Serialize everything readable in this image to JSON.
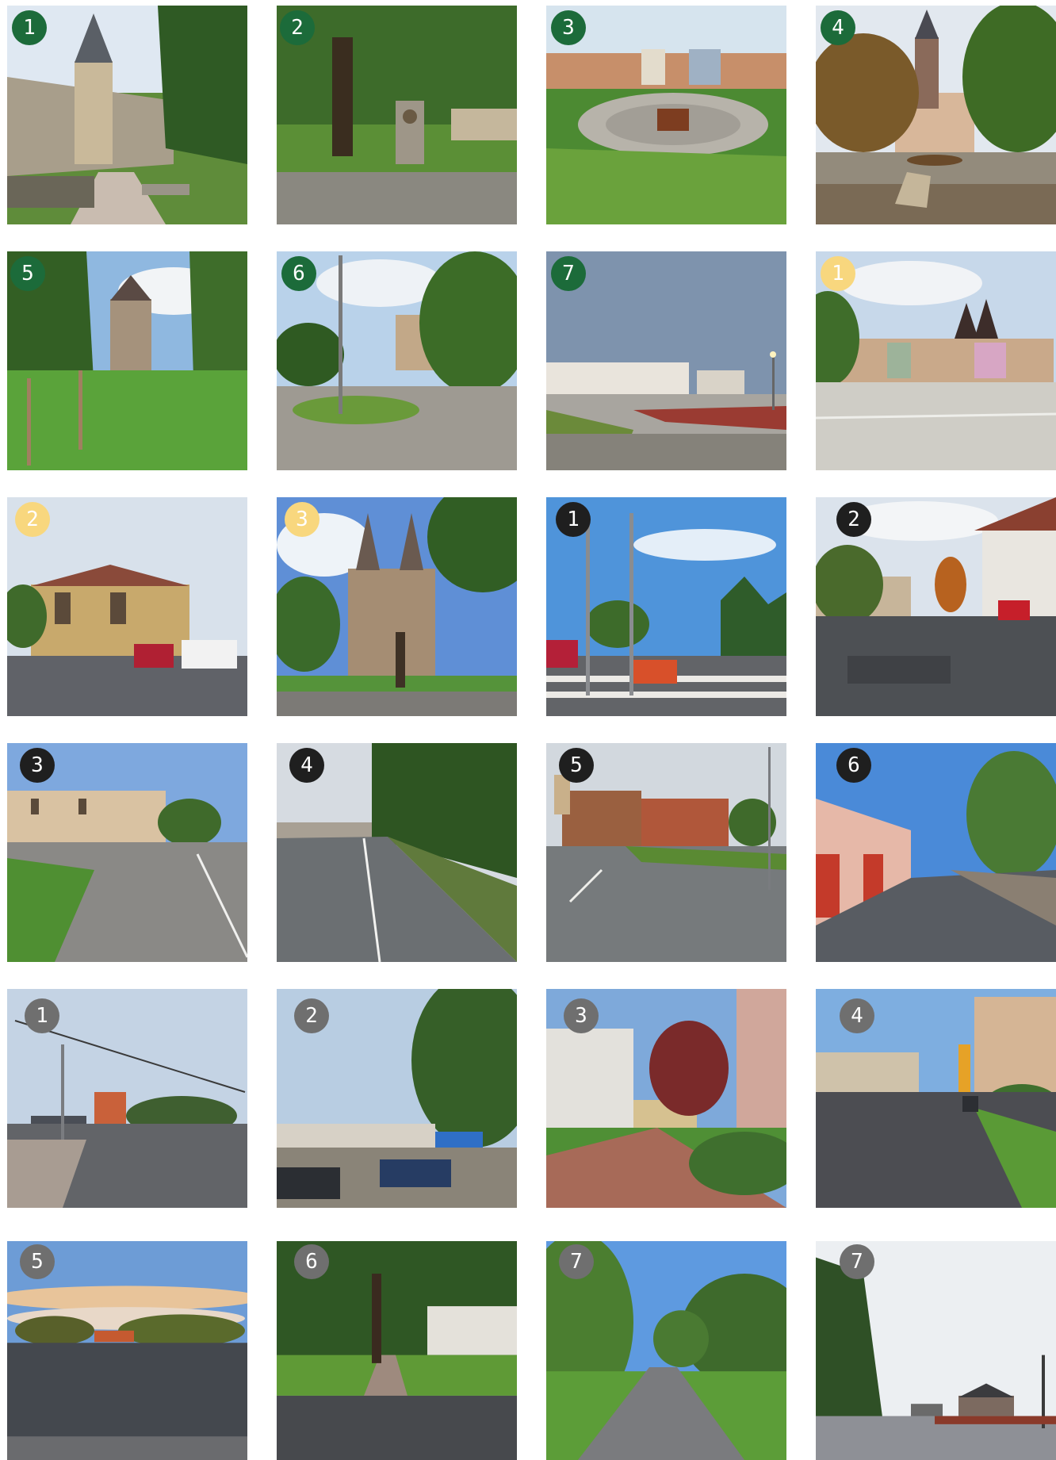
{
  "colors": {
    "green_badge": "#1c6b3a",
    "yellow_badge": "#f8d77e",
    "black_badge": "#1f1f1f",
    "gray_badge": "#6f6f6f"
  },
  "tiles": [
    {
      "badge": "1",
      "group": "green",
      "scene": "castle tower and wall path"
    },
    {
      "badge": "2",
      "group": "green",
      "scene": "park with large tree and monument"
    },
    {
      "badge": "3",
      "group": "green",
      "scene": "circular plaza with grass"
    },
    {
      "badge": "4",
      "group": "green",
      "scene": "square with church tower and stone"
    },
    {
      "badge": "5",
      "group": "green",
      "scene": "lawn with young trees and tower"
    },
    {
      "badge": "6",
      "group": "green",
      "scene": "street corner with trees and lamp"
    },
    {
      "badge": "7",
      "group": "green",
      "scene": "open plaza with buildings at dusk"
    },
    {
      "badge": "1",
      "group": "yellow",
      "scene": "town square with twin-spire church"
    },
    {
      "badge": "2",
      "group": "yellow",
      "scene": "ornate yellow building with parked vans"
    },
    {
      "badge": "3",
      "group": "yellow",
      "scene": "twin-spire gothic church"
    },
    {
      "badge": "1",
      "group": "black",
      "scene": "intersection with traffic lights"
    },
    {
      "badge": "2",
      "group": "black",
      "scene": "wide street with parked cars"
    },
    {
      "badge": "3",
      "group": "black",
      "scene": "curving road with historic building"
    },
    {
      "badge": "4",
      "group": "black",
      "scene": "straight road along tree line"
    },
    {
      "badge": "5",
      "group": "black",
      "scene": "junction with brick buildings"
    },
    {
      "badge": "6",
      "group": "black",
      "scene": "street with garages and wall"
    },
    {
      "badge": "1",
      "group": "gray",
      "scene": "road curve with lamp posts"
    },
    {
      "badge": "2",
      "group": "gray",
      "scene": "parking lot with trees"
    },
    {
      "badge": "3",
      "group": "gray",
      "scene": "school building with red-leaf tree"
    },
    {
      "badge": "4",
      "group": "gray",
      "scene": "street with aquapark slide"
    },
    {
      "badge": "5",
      "group": "gray",
      "scene": "empty paved lot at evening"
    },
    {
      "badge": "6",
      "group": "gray",
      "scene": "shaded path under trees"
    },
    {
      "badge": "7",
      "group": "gray",
      "scene": "long road through green trees"
    },
    {
      "badge": "7",
      "group": "gray",
      "scene": "residential street with distant spires"
    }
  ]
}
